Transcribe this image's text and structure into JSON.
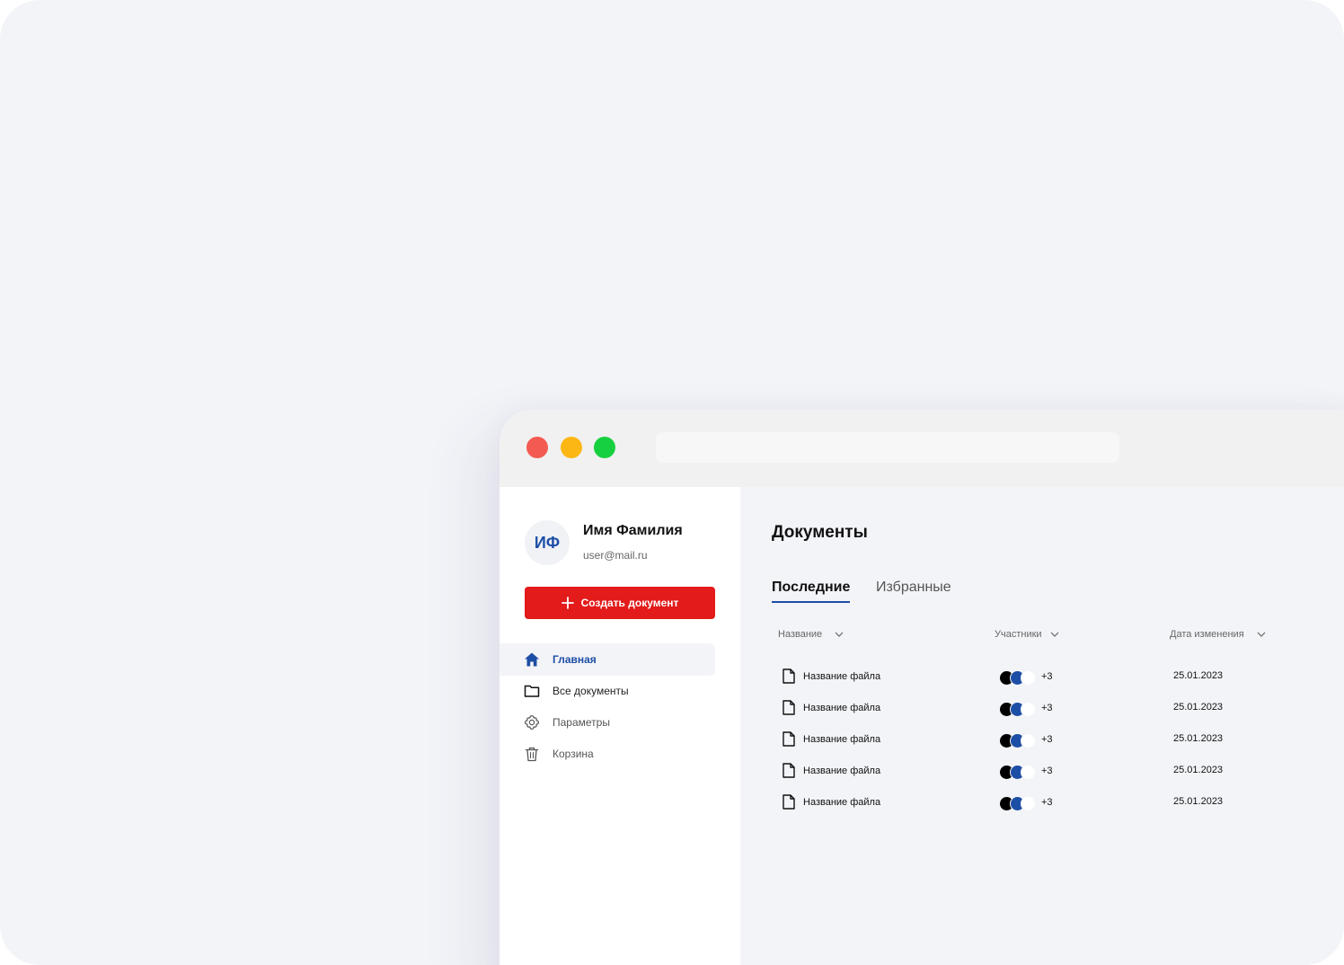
{
  "window": {
    "controls": {
      "close_color": "#f35b52",
      "minimize_color": "#fdb714",
      "maximize_color": "#17d040"
    },
    "address_bar": ""
  },
  "user": {
    "initials": "ИФ",
    "name": "Имя Фамилия",
    "email": "user@mail.ru"
  },
  "create_button": {
    "label": "Создать документ",
    "icon": "plus-icon",
    "color": "#e31b1b"
  },
  "nav": [
    {
      "label": "Главная",
      "icon": "home-icon",
      "active": true
    },
    {
      "label": "Все документы",
      "icon": "folder-icon",
      "active": false
    },
    {
      "label": "Параметры",
      "icon": "gear-icon",
      "active": false
    },
    {
      "label": "Корзина",
      "icon": "trash-icon",
      "active": false
    }
  ],
  "page": {
    "title": "Документы",
    "tabs": [
      {
        "label": "Последние",
        "active": true
      },
      {
        "label": "Избранные",
        "active": false
      }
    ]
  },
  "table": {
    "columns": [
      "Название",
      "Участники",
      "Дата изменения"
    ],
    "rows": [
      {
        "name": "Название файла",
        "participants_extra": "+3",
        "date": "25.01.2023"
      },
      {
        "name": "Название файла",
        "participants_extra": "+3",
        "date": "25.01.2023"
      },
      {
        "name": "Название файла",
        "participants_extra": "+3",
        "date": "25.01.2023"
      },
      {
        "name": "Название файла",
        "participants_extra": "+3",
        "date": "25.01.2023"
      },
      {
        "name": "Название файла",
        "participants_extra": "+3",
        "date": "25.01.2023"
      }
    ]
  },
  "colors": {
    "accent": "#1d4ea6",
    "danger": "#e31b1b",
    "background": "#f3f4f8"
  }
}
